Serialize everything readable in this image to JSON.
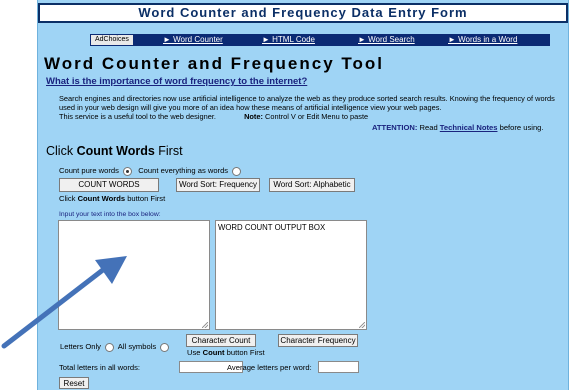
{
  "header": {
    "title": "Word Counter and Frequency Data Entry Form"
  },
  "nav": {
    "adchoices": "AdChoices",
    "links": [
      "► Word Counter",
      "► HTML Code",
      "► Word Search",
      "► Words in a Word"
    ]
  },
  "tool": {
    "title": "Word Counter and Frequency Tool",
    "question": "What is the importance of word frequency to the internet?",
    "desc1": "Search engines and directories now use artificial intelligence to analyze the web as they produce sorted search results. Knowing the frequency of words used in your web design will give you more of an idea how these means of artificial intelligence view your web pages.",
    "desc2": "This service is a useful tool to the web designer.",
    "note_label": "Note:",
    "note_text": " Control V or Edit Menu to paste",
    "attention_label": "ATTENTION:",
    "attention_pre": " Read ",
    "attention_link": "Technical Notes",
    "attention_post": " before using."
  },
  "click_first": {
    "pre": "Click ",
    "bold": "Count Words",
    "post": " First"
  },
  "options": {
    "pure": "Count pure words",
    "everything": "Count everything as words",
    "selected": "pure"
  },
  "buttons": {
    "count_words": "COUNT WORDS",
    "sort_freq": "Word Sort: Frequency",
    "sort_alpha": "Word Sort: Alphabetic",
    "char_count": "Character Count",
    "char_freq": "Character Frequency",
    "reset": "Reset"
  },
  "hint1": {
    "pre": "Click ",
    "bold": "Count Words",
    "post": " button First"
  },
  "input_label": "Input your text into the box below:",
  "output_text": "WORD COUNT OUTPUT BOX",
  "letters": {
    "only": "Letters Only",
    "all": "All symbols",
    "selected": "all"
  },
  "hint2": {
    "pre": "Use ",
    "bold": "Count",
    "post": " button First"
  },
  "totals": {
    "total_label": "Total  letters in all words:",
    "avg_label": "Average letters per word:",
    "total_value": "",
    "avg_value": ""
  }
}
